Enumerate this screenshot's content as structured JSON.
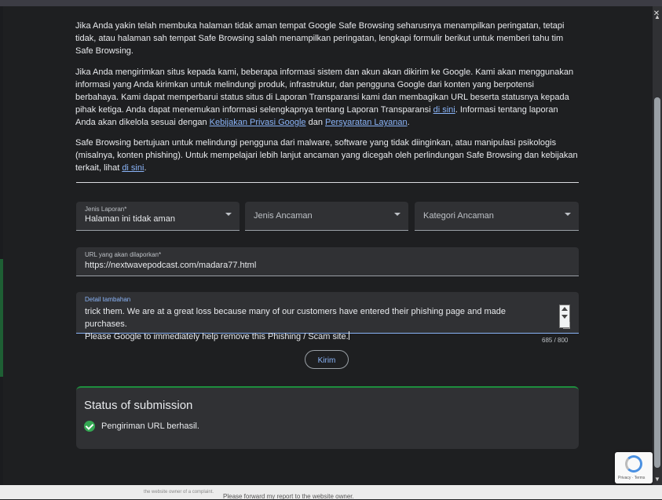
{
  "intro": {
    "p1": "Jika Anda yakin telah membuka halaman tidak aman tempat Google Safe Browsing seharusnya menampilkan peringatan, tetapi tidak, atau halaman sah tempat Safe Browsing salah menampilkan peringatan, lengkapi formulir berikut untuk memberi tahu tim Safe Browsing.",
    "p2_a": "Jika Anda mengirimkan situs kepada kami, beberapa informasi sistem dan akun akan dikirim ke Google. Kami akan menggunakan informasi yang Anda kirimkan untuk melindungi produk, infrastruktur, dan pengguna Google dari konten yang berpotensi berbahaya. Kami dapat memperbarui status situs di Laporan Transparansi kami dan membagikan URL beserta statusnya kepada pihak ketiga. Anda dapat menemukan informasi selengkapnya tentang Laporan Transparansi ",
    "p2_link1": "di sini",
    "p2_b": ". Informasi tentang laporan Anda akan dikelola sesuai dengan ",
    "p2_link2": "Kebijakan Privasi Google",
    "p2_c": " dan ",
    "p2_link3": "Persyaratan Layanan",
    "p2_d": ".",
    "p3_a": "Safe Browsing bertujuan untuk melindungi pengguna dari malware, software yang tidak diinginkan, atau manipulasi psikologis (misalnya, konten phishing). Untuk mempelajari lebih lanjut ancaman yang dicegah oleh perlindungan Safe Browsing dan kebijakan terkait, lihat ",
    "p3_link": "di sini",
    "p3_b": "."
  },
  "form": {
    "report_type_label": "Jenis Laporan*",
    "report_type_value": "Halaman ini tidak aman",
    "threat_type_placeholder": "Jenis Ancaman",
    "threat_category_placeholder": "Kategori Ancaman",
    "url_label": "URL yang akan dilaporkan*",
    "url_value": "https://nextwavepodcast.com/madara77.html",
    "details_label": "Detail tambahan",
    "details_line1": "trick them. We are at a great loss because many of our customers have entered their phishing page and made purchases.",
    "details_line2": "Please Google to immediately help remove this Phishing / Scam site.",
    "char_count": "685 / 800",
    "submit_label": "Kirim"
  },
  "status": {
    "title": "Status of submission",
    "message": "Pengiriman URL berhasil."
  },
  "recaptcha": {
    "footer": "Privacy · Terms"
  },
  "background": {
    "text1": "the website owner of a complaint.",
    "text2": "Please forward my report to the website owner."
  },
  "colors": {
    "link": "#8ab4f8",
    "success": "#34a853",
    "accent_border": "#1e8e3e"
  }
}
